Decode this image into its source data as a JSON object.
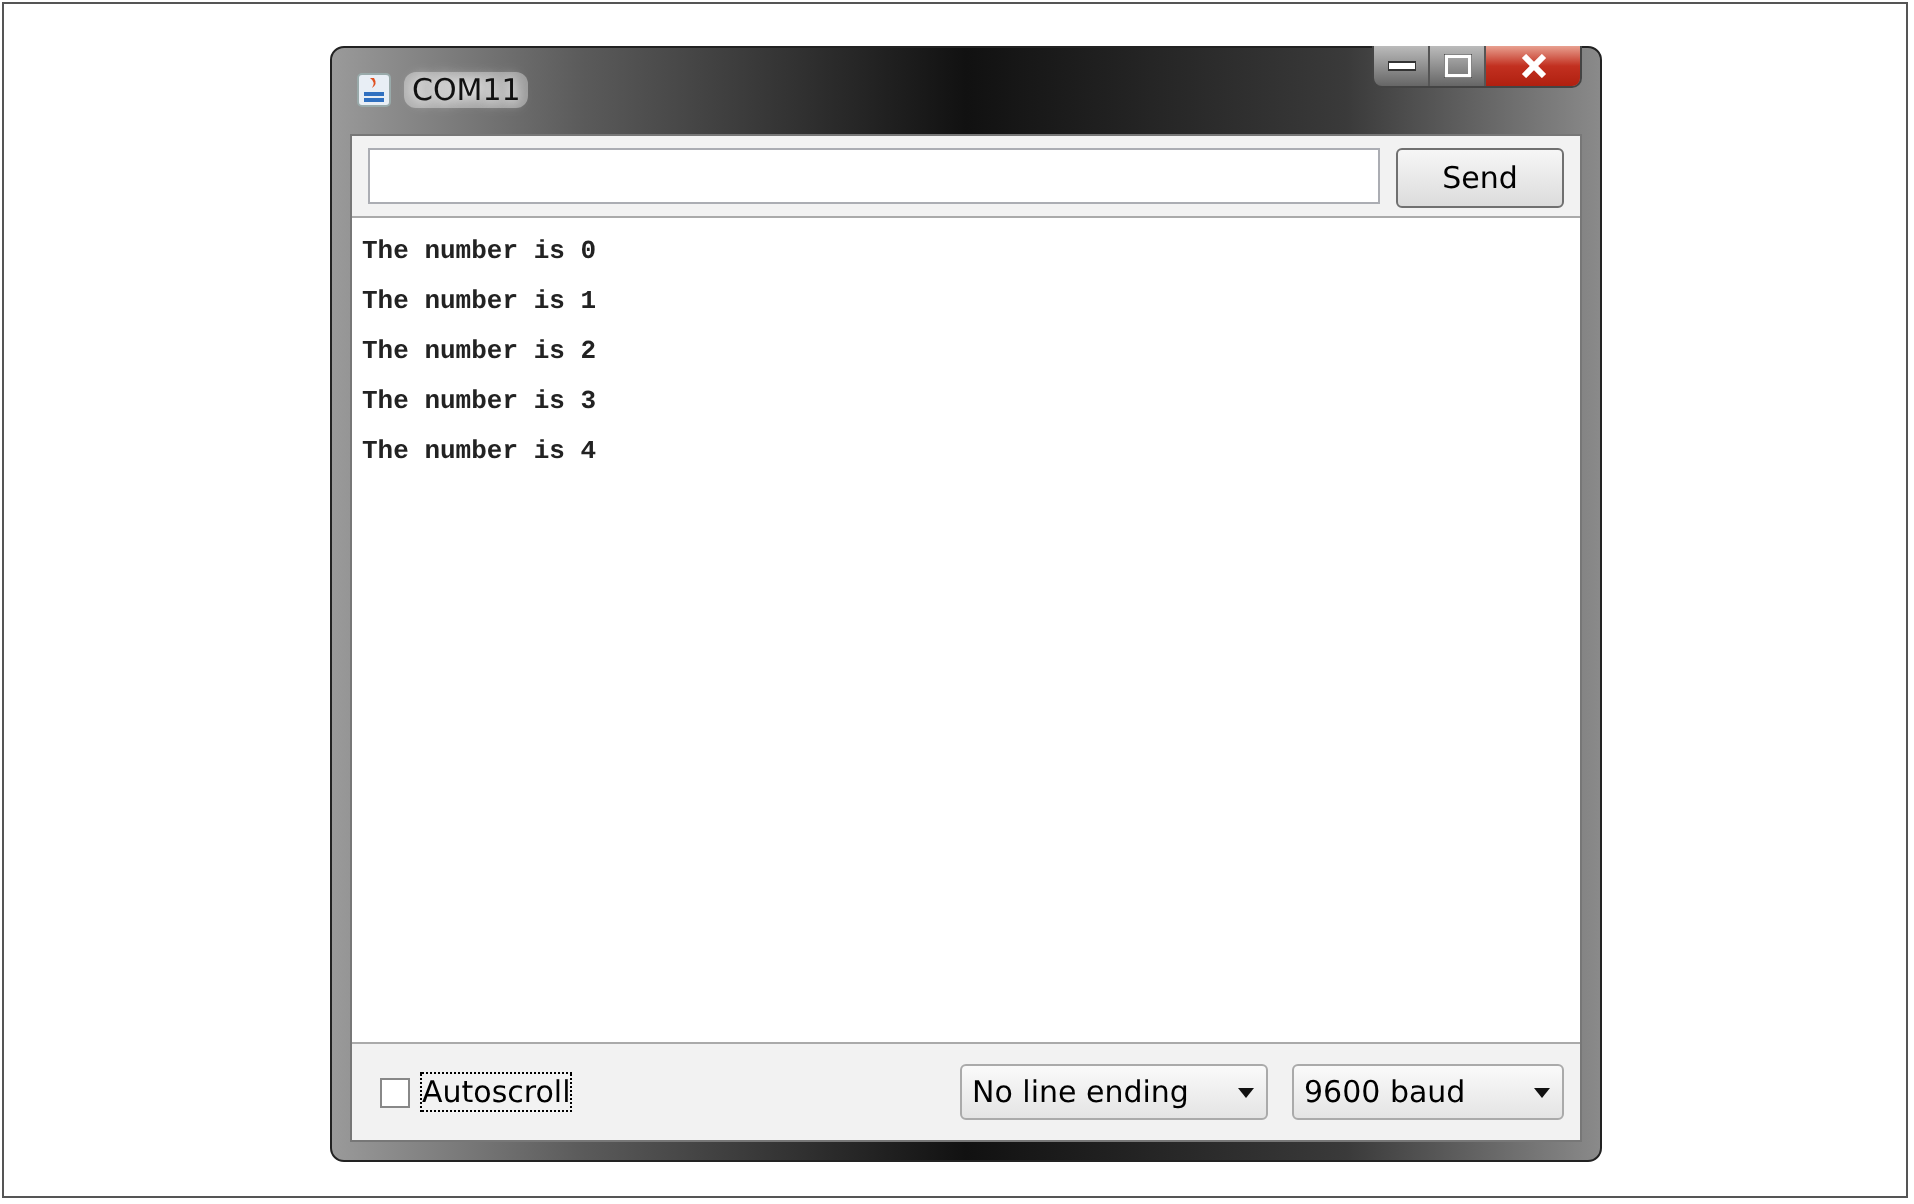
{
  "window": {
    "title": "COM11"
  },
  "send_button": {
    "label": "Send"
  },
  "output_lines": [
    "The number is 0",
    "The number is 1",
    "The number is 2",
    "The number is 3",
    "The number is 4"
  ],
  "autoscroll": {
    "label": "Autoscroll",
    "checked": false
  },
  "line_ending": {
    "value": "No line ending"
  },
  "baud_rate": {
    "value": "9600 baud"
  }
}
